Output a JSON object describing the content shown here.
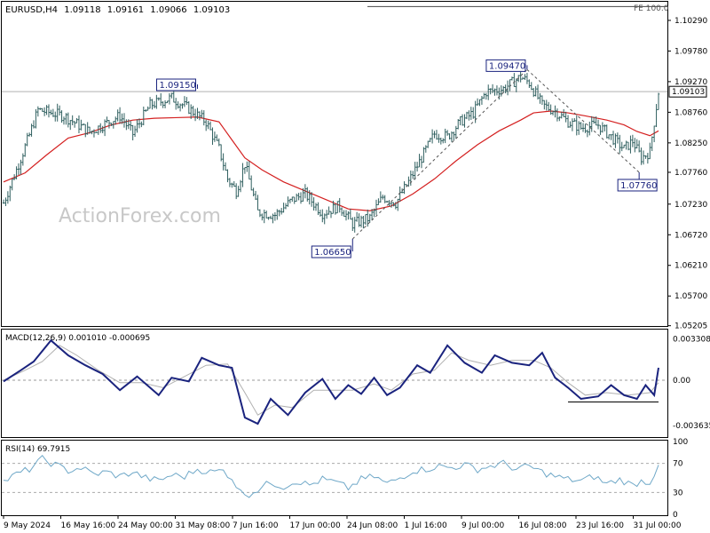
{
  "header": {
    "symbol_tf": "EURUSD,H4",
    "open": "1.09118",
    "high": "1.09161",
    "low": "1.09066",
    "close": "1.09103",
    "fe_label": "FE 100.0"
  },
  "watermark": "ActionForex.com",
  "colors": {
    "candle": "#2f5f5f",
    "ma": "#d42020",
    "macd": "#1a237e",
    "signal": "#b0b0b0",
    "rsi": "#6fa8c8",
    "frame": "#000000"
  },
  "chart_data": [
    {
      "type": "candlestick",
      "title": "EURUSD,H4",
      "ylim": [
        1.052,
        1.106
      ],
      "yticks": [
        "1.10290",
        "1.09780",
        "1.09270",
        "1.08760",
        "1.08250",
        "1.07760",
        "1.07230",
        "1.06720",
        "1.06210",
        "1.05700",
        "1.05205"
      ],
      "current_price": "1.09103",
      "x_labels": [
        "9 May 2024",
        "16 May 16:00",
        "24 May 00:00",
        "31 May 08:00",
        "7 Jun 16:00",
        "17 Jun 00:00",
        "24 Jun 08:00",
        "1 Jul 16:00",
        "9 Jul 00:00",
        "16 Jul 08:00",
        "23 Jul 16:00",
        "31 Jul 00:00"
      ],
      "anchors": [
        [
          0,
          1.0725
        ],
        [
          6,
          1.078
        ],
        [
          12,
          1.0838
        ],
        [
          16,
          1.088
        ],
        [
          28,
          1.087
        ],
        [
          40,
          1.0843
        ],
        [
          54,
          1.087
        ],
        [
          60,
          1.084
        ],
        [
          68,
          1.0888
        ],
        [
          78,
          1.09
        ],
        [
          86,
          1.0882
        ],
        [
          94,
          1.086
        ],
        [
          100,
          1.0815
        ],
        [
          104,
          1.0765
        ],
        [
          108,
          1.0745
        ],
        [
          112,
          1.079
        ],
        [
          118,
          1.071
        ],
        [
          126,
          1.0705
        ],
        [
          134,
          1.073
        ],
        [
          140,
          1.074
        ],
        [
          148,
          1.0708
        ],
        [
          156,
          1.072
        ],
        [
          162,
          1.069
        ],
        [
          170,
          1.07
        ],
        [
          176,
          1.0735
        ],
        [
          182,
          1.0725
        ],
        [
          188,
          1.076
        ],
        [
          194,
          1.08
        ],
        [
          200,
          1.084
        ],
        [
          206,
          1.0835
        ],
        [
          212,
          1.086
        ],
        [
          218,
          1.0875
        ],
        [
          224,
          1.091
        ],
        [
          232,
          1.0915
        ],
        [
          240,
          1.0935
        ],
        [
          244,
          1.0925
        ],
        [
          250,
          1.0888
        ],
        [
          256,
          1.0878
        ],
        [
          262,
          1.086
        ],
        [
          268,
          1.085
        ],
        [
          276,
          1.0855
        ],
        [
          282,
          1.0835
        ],
        [
          288,
          1.0815
        ],
        [
          292,
          1.0828
        ],
        [
          296,
          1.08
        ],
        [
          300,
          1.081
        ],
        [
          302,
          1.086
        ],
        [
          304,
          1.091
        ]
      ],
      "moving_average": [
        [
          0,
          1.076
        ],
        [
          10,
          1.0775
        ],
        [
          20,
          1.0805
        ],
        [
          30,
          1.0833
        ],
        [
          40,
          1.0842
        ],
        [
          50,
          1.0855
        ],
        [
          60,
          1.0863
        ],
        [
          70,
          1.0866
        ],
        [
          80,
          1.0867
        ],
        [
          90,
          1.0868
        ],
        [
          100,
          1.086
        ],
        [
          106,
          1.083
        ],
        [
          112,
          1.08
        ],
        [
          120,
          1.078
        ],
        [
          130,
          1.076
        ],
        [
          140,
          1.0745
        ],
        [
          150,
          1.073
        ],
        [
          160,
          1.0715
        ],
        [
          170,
          1.0712
        ],
        [
          180,
          1.072
        ],
        [
          190,
          1.074
        ],
        [
          200,
          1.0765
        ],
        [
          210,
          1.0795
        ],
        [
          220,
          1.0822
        ],
        [
          230,
          1.0845
        ],
        [
          240,
          1.0863
        ],
        [
          246,
          1.0875
        ],
        [
          254,
          1.0878
        ],
        [
          262,
          1.0875
        ],
        [
          270,
          1.087
        ],
        [
          280,
          1.0863
        ],
        [
          288,
          1.0855
        ],
        [
          294,
          1.0844
        ],
        [
          300,
          1.0837
        ],
        [
          304,
          1.0845
        ]
      ],
      "annotations": [
        {
          "text": "1.09150",
          "bar": 90,
          "price": 1.0915
        },
        {
          "text": "1.06650",
          "bar": 162,
          "price": 1.0665
        },
        {
          "text": "1.09470",
          "bar": 243,
          "price": 1.0947
        },
        {
          "text": "1.07760",
          "bar": 295,
          "price": 1.0776
        }
      ],
      "fe_line_price": 1.1052
    },
    {
      "type": "line",
      "title": "MACD(12,26,9) 0.001010 -0.000695",
      "ylim": [
        -0.0045,
        0.004
      ],
      "yticks": [
        "0.003308",
        "0.00",
        "-0.003635"
      ],
      "series": [
        {
          "name": "MACD",
          "points": [
            [
              0,
              -0.0001
            ],
            [
              8,
              0.0008
            ],
            [
              14,
              0.0015
            ],
            [
              22,
              0.0032
            ],
            [
              30,
              0.002
            ],
            [
              38,
              0.0012
            ],
            [
              46,
              0.0005
            ],
            [
              54,
              -0.0008
            ],
            [
              62,
              0.0003
            ],
            [
              72,
              -0.0012
            ],
            [
              78,
              0.0002
            ],
            [
              86,
              -0.0001
            ],
            [
              92,
              0.0018
            ],
            [
              100,
              0.0012
            ],
            [
              106,
              0.001
            ],
            [
              112,
              -0.003
            ],
            [
              118,
              -0.0035
            ],
            [
              124,
              -0.0015
            ],
            [
              132,
              -0.0028
            ],
            [
              140,
              -0.001
            ],
            [
              148,
              0.0001
            ],
            [
              154,
              -0.0015
            ],
            [
              160,
              -0.0004
            ],
            [
              166,
              -0.0011
            ],
            [
              172,
              0.0002
            ],
            [
              178,
              -0.0012
            ],
            [
              184,
              -0.0006
            ],
            [
              192,
              0.0012
            ],
            [
              198,
              0.0006
            ],
            [
              206,
              0.0028
            ],
            [
              214,
              0.0014
            ],
            [
              222,
              0.0006
            ],
            [
              228,
              0.002
            ],
            [
              236,
              0.0014
            ],
            [
              244,
              0.0012
            ],
            [
              250,
              0.0022
            ],
            [
              256,
              0.0002
            ],
            [
              262,
              -0.0006
            ],
            [
              268,
              -0.0015
            ],
            [
              276,
              -0.0013
            ],
            [
              282,
              -0.0004
            ],
            [
              288,
              -0.0012
            ],
            [
              294,
              -0.0015
            ],
            [
              298,
              -0.0004
            ],
            [
              302,
              -0.0012
            ],
            [
              304,
              0.001
            ]
          ]
        },
        {
          "name": "Signal",
          "points": [
            [
              0,
              0.0
            ],
            [
              10,
              0.0008
            ],
            [
              18,
              0.0015
            ],
            [
              26,
              0.0028
            ],
            [
              34,
              0.002
            ],
            [
              44,
              0.0008
            ],
            [
              54,
              -0.0002
            ],
            [
              64,
              -0.0002
            ],
            [
              74,
              -0.0006
            ],
            [
              84,
              0.0003
            ],
            [
              94,
              0.0012
            ],
            [
              104,
              0.0013
            ],
            [
              112,
              -0.001
            ],
            [
              118,
              -0.0028
            ],
            [
              126,
              -0.002
            ],
            [
              134,
              -0.0022
            ],
            [
              144,
              -0.0008
            ],
            [
              152,
              -0.0008
            ],
            [
              162,
              -0.0008
            ],
            [
              172,
              -0.0003
            ],
            [
              180,
              -0.0008
            ],
            [
              190,
              0.0005
            ],
            [
              200,
              0.0008
            ],
            [
              208,
              0.0022
            ],
            [
              216,
              0.0016
            ],
            [
              226,
              0.0012
            ],
            [
              236,
              0.0016
            ],
            [
              246,
              0.0016
            ],
            [
              254,
              0.001
            ],
            [
              262,
              -0.0002
            ],
            [
              270,
              -0.0012
            ],
            [
              280,
              -0.001
            ],
            [
              290,
              -0.0012
            ],
            [
              300,
              -0.001
            ],
            [
              304,
              -0.0002
            ]
          ]
        }
      ],
      "zero_line": 0.0,
      "flat_line": -0.00175
    },
    {
      "type": "line",
      "title": "RSI(14) 69.7915",
      "ylim": [
        0,
        100
      ],
      "yticks": [
        "100",
        "70",
        "30",
        "0"
      ],
      "levels": [
        70,
        30
      ],
      "series": [
        {
          "name": "RSI",
          "points": [
            [
              0,
              45
            ],
            [
              6,
              55
            ],
            [
              12,
              62
            ],
            [
              18,
              76
            ],
            [
              24,
              68
            ],
            [
              30,
              60
            ],
            [
              36,
              64
            ],
            [
              42,
              55
            ],
            [
              48,
              58
            ],
            [
              54,
              52
            ],
            [
              60,
              58
            ],
            [
              66,
              50
            ],
            [
              72,
              46
            ],
            [
              78,
              54
            ],
            [
              84,
              52
            ],
            [
              90,
              62
            ],
            [
              96,
              58
            ],
            [
              102,
              60
            ],
            [
              106,
              50
            ],
            [
              110,
              30
            ],
            [
              114,
              28
            ],
            [
              118,
              34
            ],
            [
              124,
              44
            ],
            [
              130,
              38
            ],
            [
              136,
              46
            ],
            [
              142,
              40
            ],
            [
              148,
              48
            ],
            [
              154,
              44
            ],
            [
              160,
              36
            ],
            [
              166,
              48
            ],
            [
              172,
              52
            ],
            [
              178,
              42
            ],
            [
              184,
              50
            ],
            [
              190,
              60
            ],
            [
              196,
              62
            ],
            [
              202,
              66
            ],
            [
              208,
              64
            ],
            [
              214,
              68
            ],
            [
              220,
              62
            ],
            [
              226,
              66
            ],
            [
              232,
              70
            ],
            [
              238,
              62
            ],
            [
              244,
              66
            ],
            [
              250,
              58
            ],
            [
              256,
              52
            ],
            [
              262,
              48
            ],
            [
              268,
              46
            ],
            [
              274,
              52
            ],
            [
              280,
              42
            ],
            [
              286,
              48
            ],
            [
              292,
              40
            ],
            [
              296,
              46
            ],
            [
              300,
              44
            ],
            [
              302,
              56
            ],
            [
              304,
              70
            ]
          ]
        }
      ]
    }
  ]
}
